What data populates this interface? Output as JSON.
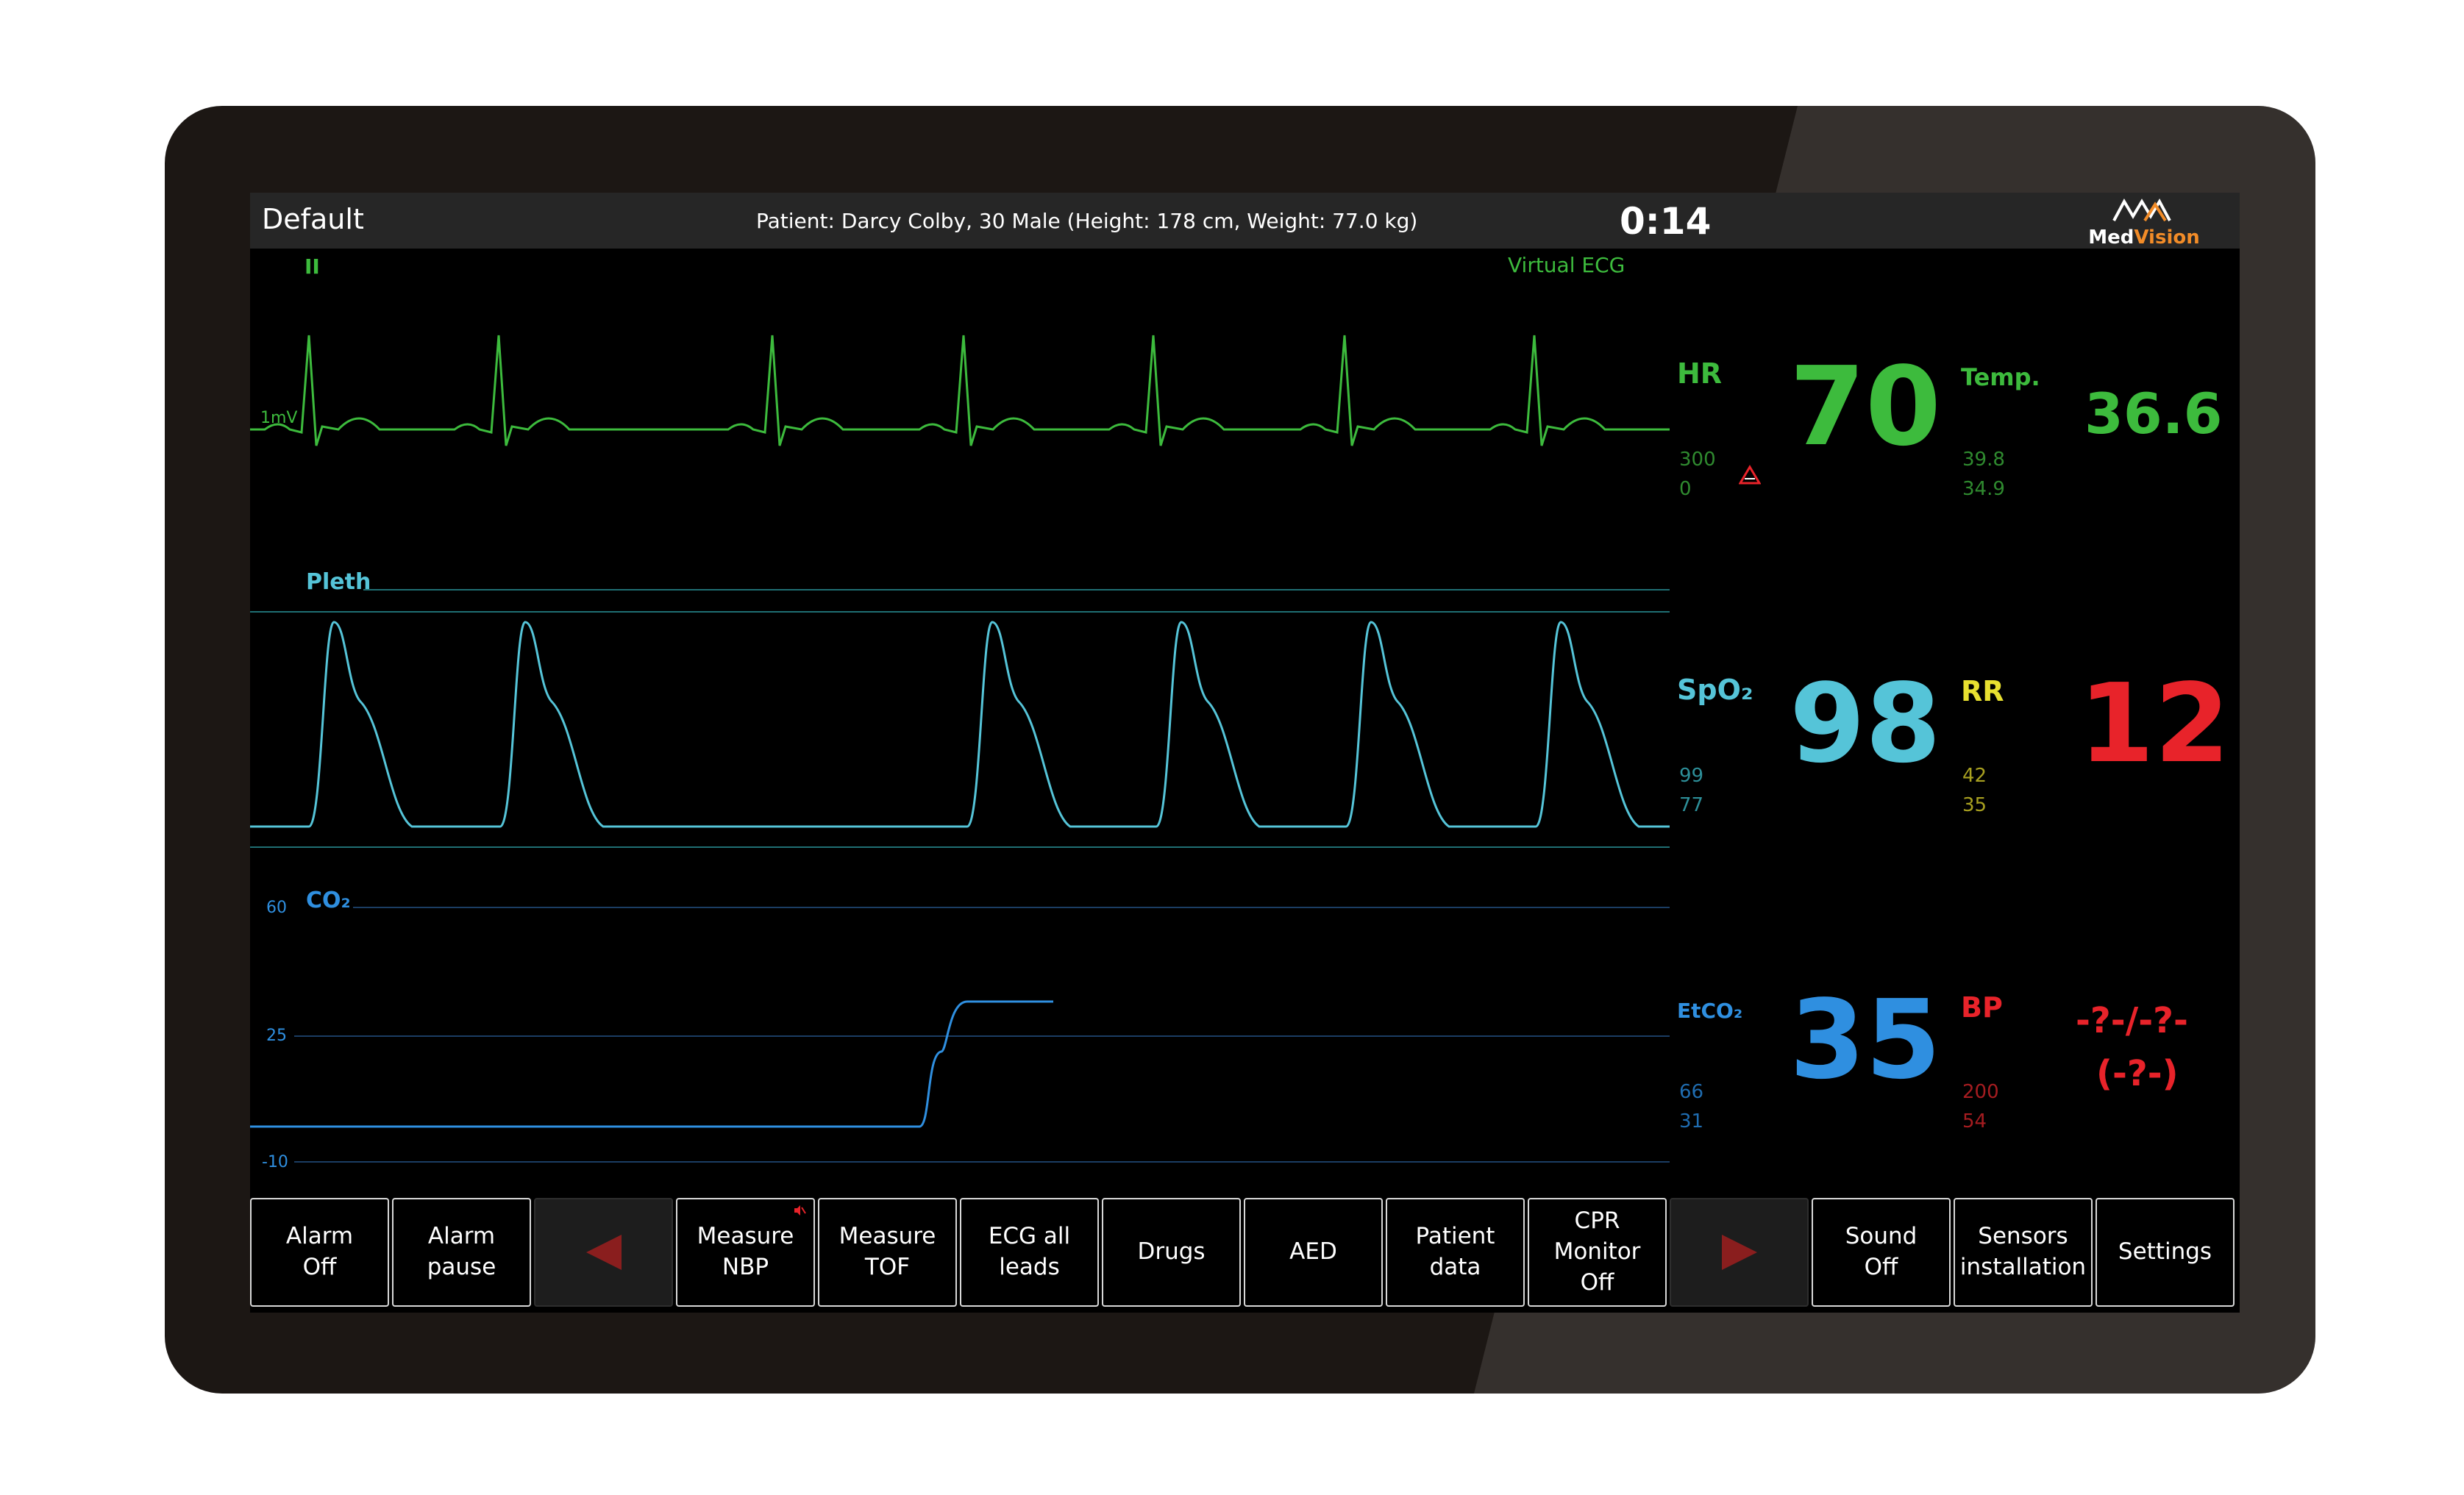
{
  "header": {
    "profile": "Default",
    "patient": "Patient: Darcy Colby, 30 Male   (Height: 178 cm, Weight: 77.0 kg)",
    "timer": "0:14",
    "logo_text_1": "Med",
    "logo_text_2": "Vision",
    "logo_icon": "medvision-logo-icon"
  },
  "waveforms": {
    "ecg": {
      "lead": "II",
      "source": "Virtual ECG",
      "scale": "1mV",
      "color": "#3dbb3d"
    },
    "pleth": {
      "label": "Pleth",
      "color": "#55c4d8"
    },
    "co2": {
      "label": "CO₂",
      "scale_ticks": [
        "60",
        "25",
        "-10"
      ],
      "color": "#2f8fe0"
    }
  },
  "params": {
    "hr": {
      "label": "HR",
      "value": "70",
      "high": "300",
      "low": "0",
      "color": "#3dbb3d",
      "alarm_icon": "alarm-triangle-icon"
    },
    "temp": {
      "label": "Temp.",
      "value": "36.6",
      "high": "39.8",
      "low": "34.9",
      "color": "#3dbb3d"
    },
    "spo2": {
      "label": "SpO₂",
      "value": "98",
      "high": "99",
      "low": "77",
      "color": "#55c4d8"
    },
    "rr": {
      "label": "RR",
      "value": "12",
      "high": "42",
      "low": "35",
      "label_color": "#e8e030",
      "value_color": "#e8232a"
    },
    "etco2": {
      "label": "EtCO₂",
      "value": "35",
      "high": "66",
      "low": "31",
      "color": "#2f8fe0"
    },
    "bp": {
      "label": "BP",
      "value_line1": "-?-/-?-",
      "value_line2": "(-?-)",
      "high": "200",
      "low": "54",
      "color": "#e8232a"
    }
  },
  "buttons": [
    {
      "id": "alarm-off",
      "label": "Alarm\nOff"
    },
    {
      "id": "alarm-pause",
      "label": "Alarm pause"
    },
    {
      "id": "prev-page",
      "label": "",
      "icon": "arrow-left-icon"
    },
    {
      "id": "measure-nbp",
      "label": "Measure\nNBP",
      "icon": "mute-icon"
    },
    {
      "id": "measure-tof",
      "label": "Measure\nTOF"
    },
    {
      "id": "ecg-all-leads",
      "label": "ECG all\nleads"
    },
    {
      "id": "drugs",
      "label": "Drugs"
    },
    {
      "id": "aed",
      "label": "AED"
    },
    {
      "id": "patient-data",
      "label": "Patient data"
    },
    {
      "id": "cpr-monitor",
      "label": "CPR\nMonitor\nOff"
    },
    {
      "id": "next-page",
      "label": "",
      "icon": "arrow-right-icon"
    },
    {
      "id": "sound-off",
      "label": "Sound\nOff"
    },
    {
      "id": "sensors-installation",
      "label": "Sensors\ninstallation"
    },
    {
      "id": "settings",
      "label": "Settings"
    }
  ]
}
